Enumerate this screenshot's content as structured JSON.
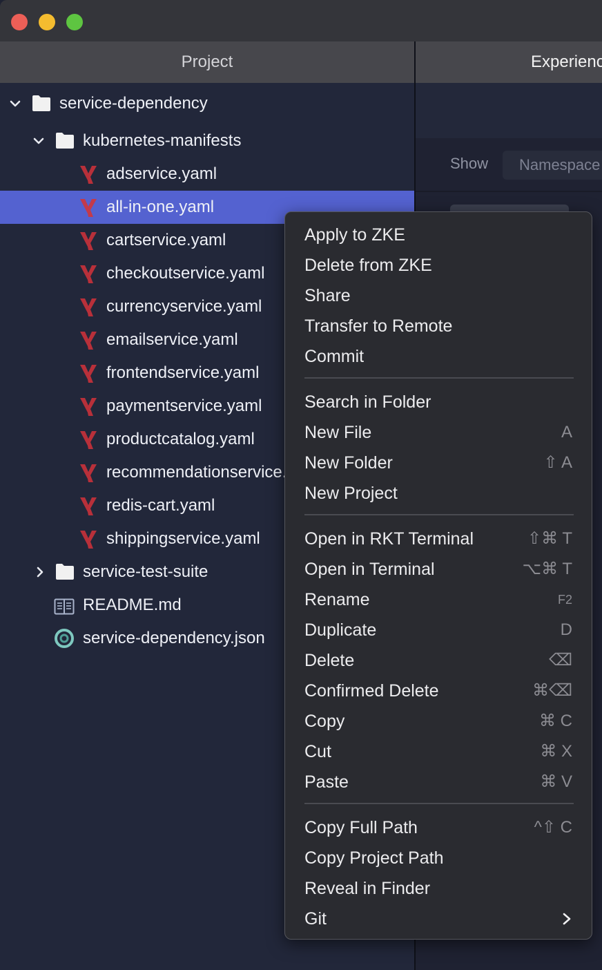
{
  "window": {
    "tabs": [
      {
        "label": "Project"
      },
      {
        "label": "Experiences"
      }
    ]
  },
  "tree": {
    "root": {
      "label": "service-dependency",
      "expanded": true
    },
    "folder": {
      "label": "kubernetes-manifests",
      "expanded": true
    },
    "files": [
      {
        "label": "adservice.yaml"
      },
      {
        "label": "all-in-one.yaml",
        "selected": true
      },
      {
        "label": "cartservice.yaml"
      },
      {
        "label": "checkoutservice.yaml"
      },
      {
        "label": "currencyservice.yaml"
      },
      {
        "label": "emailservice.yaml"
      },
      {
        "label": "frontendservice.yaml"
      },
      {
        "label": "paymentservice.yaml"
      },
      {
        "label": "productcatalog.yaml"
      },
      {
        "label": "recommendationservice.yaml"
      },
      {
        "label": "redis-cart.yaml"
      },
      {
        "label": "shippingservice.yaml"
      }
    ],
    "siblings": [
      {
        "label": "service-test-suite",
        "kind": "folder",
        "expanded": false
      },
      {
        "label": "README.md",
        "kind": "markdown"
      },
      {
        "label": "service-dependency.json",
        "kind": "json"
      }
    ]
  },
  "right_panel": {
    "show_label": "Show",
    "namespace_label": "Namespace"
  },
  "context_menu": {
    "items": [
      {
        "label": "Apply to ZKE",
        "shortcut": ""
      },
      {
        "label": "Delete from ZKE",
        "shortcut": ""
      },
      {
        "label": "Share",
        "shortcut": ""
      },
      {
        "label": "Transfer to Remote",
        "shortcut": ""
      },
      {
        "label": "Commit",
        "shortcut": ""
      },
      {
        "label": "Search in Folder",
        "shortcut": ""
      },
      {
        "label": "New File",
        "shortcut": "A"
      },
      {
        "label": "New Folder",
        "shortcut": "⇧ A"
      },
      {
        "label": "New Project",
        "shortcut": ""
      },
      {
        "label": "Open in RKT Terminal",
        "shortcut": "⇧⌘ T"
      },
      {
        "label": "Open in Terminal",
        "shortcut": "⌥⌘ T"
      },
      {
        "label": "Rename",
        "shortcut": "F2"
      },
      {
        "label": "Duplicate",
        "shortcut": "D"
      },
      {
        "label": "Delete",
        "shortcut": "⌫"
      },
      {
        "label": "Confirmed Delete",
        "shortcut": "⌘⌫"
      },
      {
        "label": "Copy",
        "shortcut": "⌘ C"
      },
      {
        "label": "Cut",
        "shortcut": "⌘ X"
      },
      {
        "label": "Paste",
        "shortcut": "⌘ V"
      },
      {
        "label": "Copy Full Path",
        "shortcut": "^⇧ C"
      },
      {
        "label": "Copy Project Path",
        "shortcut": ""
      },
      {
        "label": "Reveal in Finder",
        "shortcut": ""
      },
      {
        "label": "Git",
        "shortcut": "",
        "submenu": true
      }
    ]
  },
  "colors": {
    "selection": "#5462d0",
    "yaml_icon": "#b8303a",
    "json_icon": "#7ec8bf",
    "close": "#ec5f57",
    "minimize": "#f4bc2f",
    "zoom": "#5ec541"
  }
}
